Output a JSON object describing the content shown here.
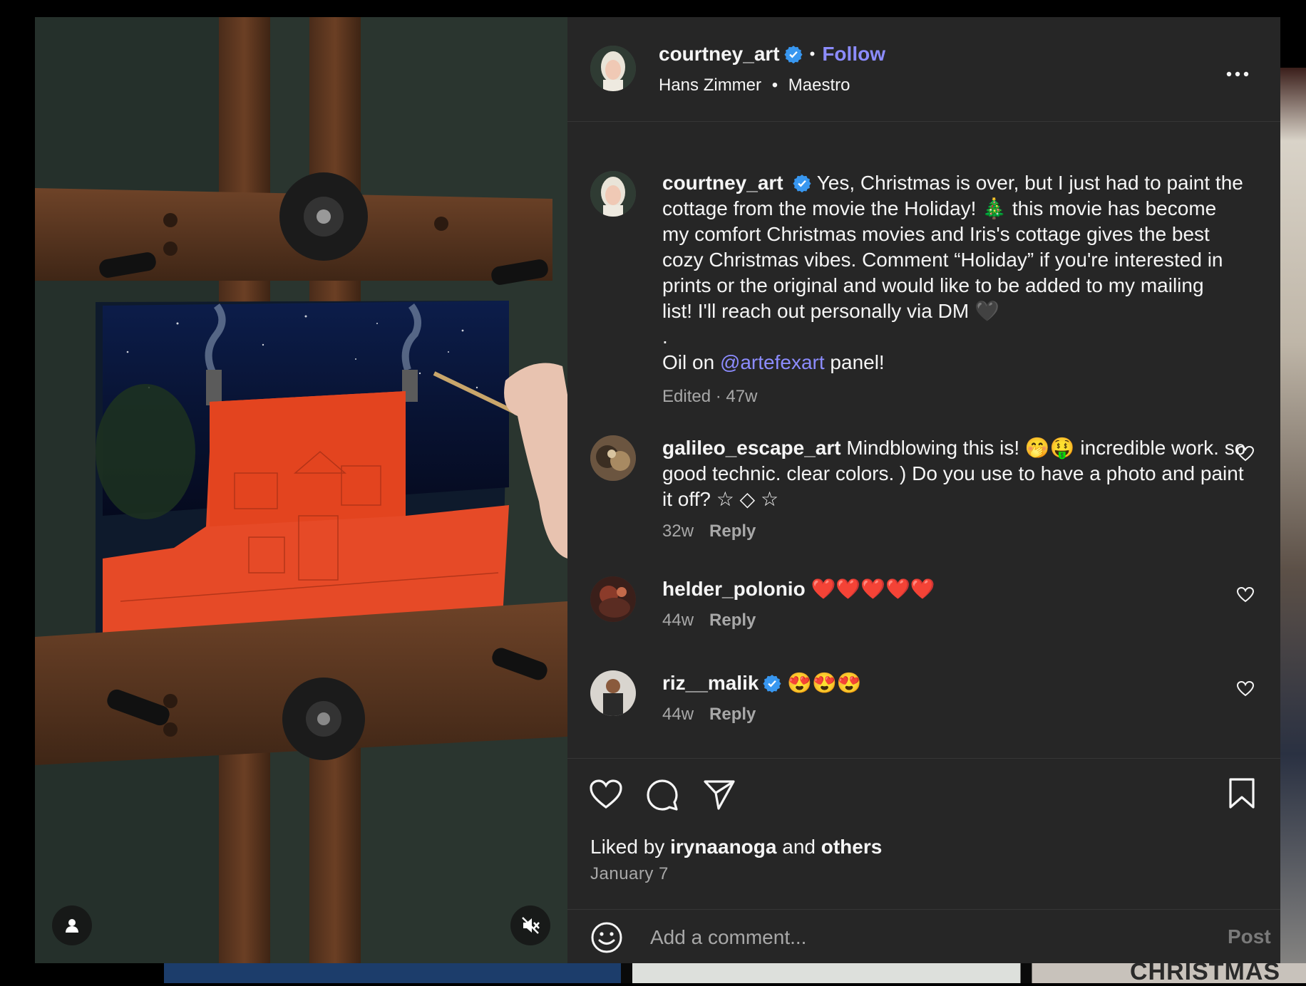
{
  "colors": {
    "modal_bg": "#262626",
    "accent_link": "#8c8cff",
    "verified": "#3897f0",
    "muted_text": "#a8a8a8"
  },
  "background": {
    "partial_text": "CHRISTMAS"
  },
  "media": {
    "user_icon": "user-icon",
    "mute_icon": "speaker-muted-icon"
  },
  "header": {
    "username": "courtney_art",
    "follow_label": "Follow",
    "separator": "•",
    "audio_artist": "Hans Zimmer",
    "audio_title": "Maestro"
  },
  "caption": {
    "username": "courtney_art",
    "text_lines": [
      "Yes, Christmas is over, but I just had to paint the",
      "cottage from the movie the Holiday! 🎄 this movie has become",
      "my comfort Christmas movies and Iris's cottage gives the best",
      "cozy Christmas vibes. Comment “Holiday” if you're interested in",
      "prints or the original and would like to be added to my mailing",
      "list! I'll reach out personally via DM 🖤"
    ],
    "dot_line": ".",
    "oil_prefix": "Oil on ",
    "oil_mention": "@artefexart",
    "oil_suffix": " panel!",
    "meta": "Edited · 47w"
  },
  "comments": [
    {
      "username": "galileo_escape_art",
      "text": "Mindblowing this is! 🤭🤑 incredible work. so good technic. clear colors. ) Do you use to have a photo and paint it off? ☆ ◇ ☆",
      "age": "32w",
      "reply": "Reply",
      "verified": false
    },
    {
      "username": "helder_polonio",
      "text": "❤️❤️❤️❤️❤️",
      "age": "44w",
      "reply": "Reply",
      "verified": false
    },
    {
      "username": "riz__malik",
      "text": "😍😍😍",
      "age": "44w",
      "reply": "Reply",
      "verified": true
    }
  ],
  "actions": {
    "like_icon": "heart-icon",
    "comment_icon": "comment-icon",
    "share_icon": "share-icon",
    "save_icon": "bookmark-icon",
    "liked_by_prefix": "Liked by ",
    "liked_by_user": "irynaanoga",
    "liked_by_and": " and ",
    "liked_by_others": "others",
    "date": "January 7"
  },
  "add_comment": {
    "placeholder": "Add a comment...",
    "post_label": "Post",
    "emoji_icon": "emoji-icon"
  }
}
